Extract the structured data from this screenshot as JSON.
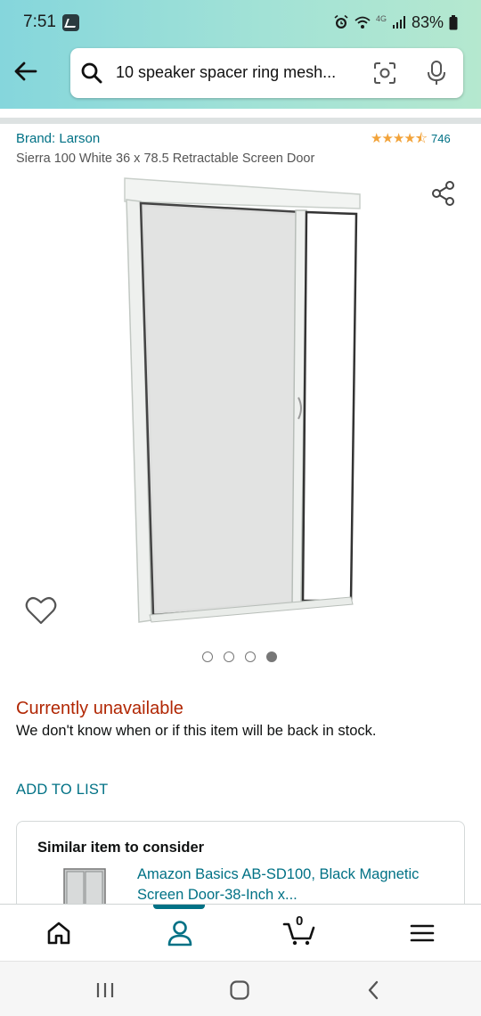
{
  "status_bar": {
    "time": "7:51",
    "network": "4G",
    "battery": "83%"
  },
  "search": {
    "query": "10 speaker spacer ring mesh..."
  },
  "product": {
    "brand": "Brand: Larson",
    "rating_value": 4.5,
    "rating_count": "746",
    "title": "Sierra 100 White 36 x 78.5 Retractable Screen Door",
    "image_count": 4,
    "active_image_index": 4
  },
  "availability": {
    "status": "Currently unavailable",
    "detail": "We don't know when or if this item will be back in stock."
  },
  "actions": {
    "add_to_list": "ADD TO LIST"
  },
  "similar_item": {
    "heading": "Similar item to consider",
    "link": "Amazon Basics AB-SD100, Black Magnetic Screen Door-38-Inch x..."
  },
  "bottom_nav": {
    "cart_count": "0",
    "items": [
      "home-icon",
      "account-icon",
      "cart-icon",
      "menu-icon"
    ]
  },
  "colors": {
    "link": "#007185",
    "unavailable": "#b12704",
    "star": "#f2a33a",
    "header_gradient_start": "#85d6dc",
    "header_gradient_end": "#b5e8cf"
  }
}
